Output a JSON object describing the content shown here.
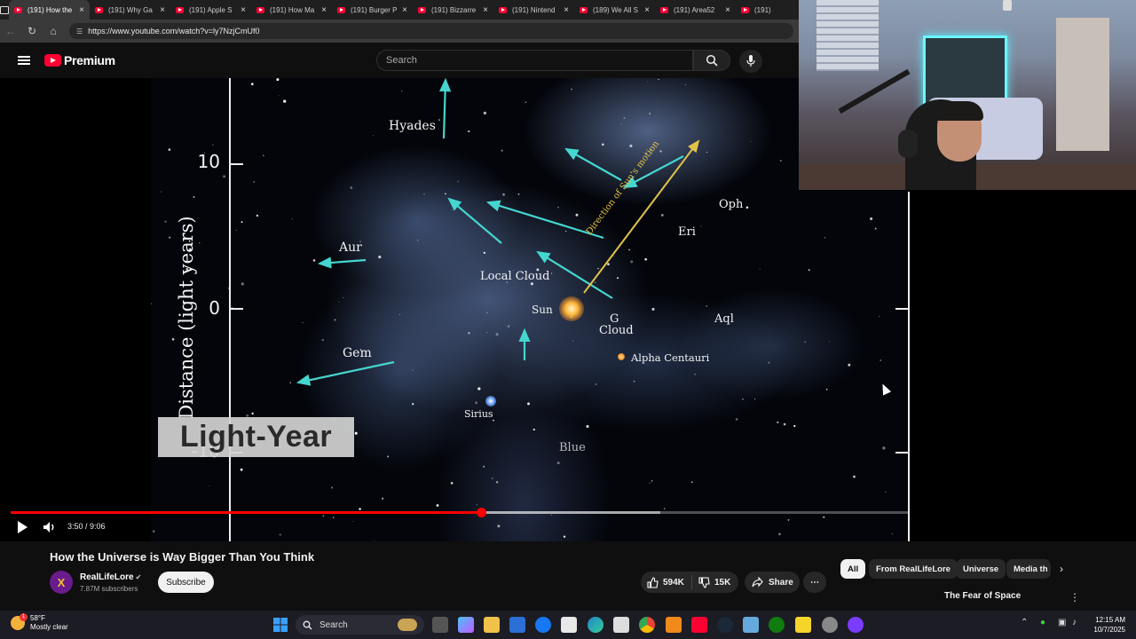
{
  "browser": {
    "tabs": [
      {
        "label": "(191) How the",
        "active": true
      },
      {
        "label": "(191) Why Ga",
        "active": false
      },
      {
        "label": "(191) Apple S",
        "active": false
      },
      {
        "label": "(191) How Ma",
        "active": false
      },
      {
        "label": "(191) Burger P",
        "active": false
      },
      {
        "label": "(191) Bizzarre",
        "active": false
      },
      {
        "label": "(191) Nintend",
        "active": false
      },
      {
        "label": "(189) We All S",
        "active": false
      },
      {
        "label": "(191) Area52",
        "active": false
      },
      {
        "label": "(191)",
        "active": false
      }
    ],
    "url": "https://www.youtube.com/watch?v=ly7NzjCmUf0"
  },
  "youtube": {
    "logo_text": "Premium",
    "search_placeholder": "Search"
  },
  "video": {
    "axis_title": "Distance (light years)",
    "ticks": [
      "10",
      "0",
      "-10"
    ],
    "labels": {
      "hyades": "Hyades",
      "aur": "Aur",
      "local_cloud": "Local Cloud",
      "sun": "Sun",
      "g_cloud_1": "G",
      "g_cloud_2": "Cloud",
      "eri": "Eri",
      "oph": "Oph",
      "aql": "Aql",
      "gem": "Gem",
      "alpha_centauri": "Alpha Centauri",
      "sirius": "Sirius",
      "sun_motion": "Direction of Sun's motion"
    },
    "overlay_title": "Light-Year",
    "bottom_word": "Blue",
    "watermark": "X",
    "current_time": "3:50",
    "duration": "9:06",
    "progress_fraction": 0.422,
    "buffer_fraction": 0.583
  },
  "below": {
    "title": "How the Universe is Way Bigger Than You Think",
    "channel": "RealLifeLore",
    "avatar_letter": "X",
    "subscribers": "7.87M subscribers",
    "subscribe_label": "Subscribe",
    "likes": "594K",
    "dislikes": "15K",
    "share_label": "Share",
    "chips": [
      "All",
      "From RealLifeLore",
      "Universe",
      "Media th"
    ],
    "rec_title": "The Fear of Space"
  },
  "taskbar": {
    "temperature": "58°F",
    "weather": "Mostly clear",
    "badge": "1",
    "search_label": "Search",
    "time": "12:15 AM",
    "date": "10/7/2025"
  },
  "colors": {
    "yt_red": "#ff0033",
    "progress_red": "#ff0000",
    "arrow_cyan": "#45d6cf",
    "motion_yellow": "#e3c24a"
  }
}
